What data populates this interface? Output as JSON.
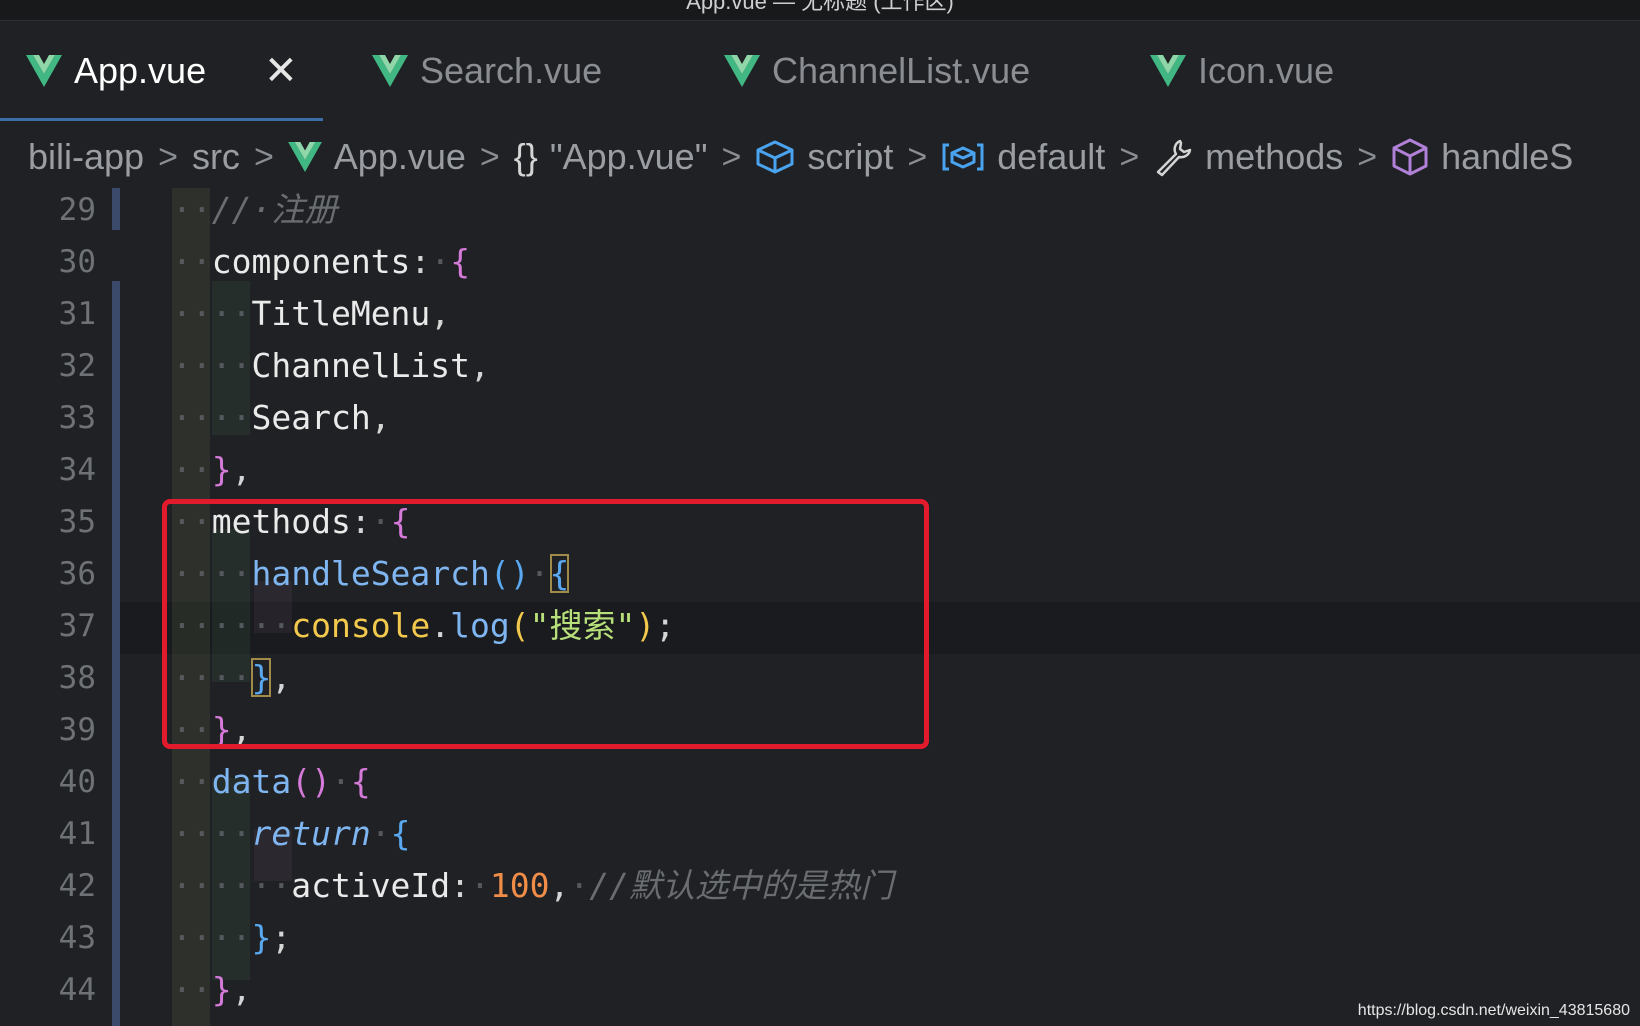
{
  "window": {
    "title": "App.vue — 无标题 (工作区)"
  },
  "tabs": [
    {
      "label": "App.vue",
      "active": true,
      "icon": "vue-icon"
    },
    {
      "label": "Search.vue",
      "active": false,
      "icon": "vue-icon"
    },
    {
      "label": "ChannelList.vue",
      "active": false,
      "icon": "vue-icon"
    },
    {
      "label": "Icon.vue",
      "active": false,
      "icon": "vue-icon"
    }
  ],
  "breadcrumb": [
    {
      "label": "bili-app",
      "icon": null
    },
    {
      "label": "src",
      "icon": null
    },
    {
      "label": "App.vue",
      "icon": "vue-icon"
    },
    {
      "label": "\"App.vue\"",
      "icon": "braces-icon",
      "icon_text": "{}"
    },
    {
      "label": "script",
      "icon": "cube-icon"
    },
    {
      "label": "default",
      "icon": "module-icon"
    },
    {
      "label": "methods",
      "icon": "wrench-icon"
    },
    {
      "label": "handleS",
      "icon": "method-cube-icon"
    }
  ],
  "editor": {
    "line_numbers": [
      "29",
      "30",
      "31",
      "32",
      "33",
      "34",
      "35",
      "36",
      "37",
      "38",
      "39",
      "40",
      "41",
      "42",
      "43",
      "44"
    ],
    "lines": [
      {
        "ws": "··",
        "tokens": [
          {
            "t": "//·注册",
            "c": "c-com"
          }
        ]
      },
      {
        "ws": "··",
        "tokens": [
          {
            "t": "components",
            "c": "c-prop"
          },
          {
            "t": ":",
            "c": "c-punc"
          },
          {
            "t": "·",
            "c": "ws"
          },
          {
            "t": "{",
            "c": "c-brace1"
          }
        ]
      },
      {
        "ws": "····",
        "tokens": [
          {
            "t": "TitleMenu",
            "c": "c-prop"
          },
          {
            "t": ",",
            "c": "c-punc"
          }
        ]
      },
      {
        "ws": "····",
        "tokens": [
          {
            "t": "ChannelList",
            "c": "c-prop"
          },
          {
            "t": ",",
            "c": "c-punc"
          }
        ]
      },
      {
        "ws": "····",
        "tokens": [
          {
            "t": "Search",
            "c": "c-prop"
          },
          {
            "t": ",",
            "c": "c-punc"
          }
        ]
      },
      {
        "ws": "··",
        "tokens": [
          {
            "t": "}",
            "c": "c-brace1"
          },
          {
            "t": ",",
            "c": "c-punc"
          }
        ]
      },
      {
        "ws": "··",
        "tokens": [
          {
            "t": "methods",
            "c": "c-prop"
          },
          {
            "t": ":",
            "c": "c-punc"
          },
          {
            "t": "·",
            "c": "ws"
          },
          {
            "t": "{",
            "c": "c-brace1"
          }
        ]
      },
      {
        "ws": "····",
        "tokens": [
          {
            "t": "handleSearch",
            "c": "c-fn"
          },
          {
            "t": "()",
            "c": "c-brace2"
          },
          {
            "t": "·",
            "c": "ws"
          },
          {
            "t": "{",
            "c": "c-brace2 bracket-box"
          }
        ]
      },
      {
        "ws": "······",
        "tokens": [
          {
            "t": "console",
            "c": "c-obj"
          },
          {
            "t": ".",
            "c": "c-punc"
          },
          {
            "t": "log",
            "c": "c-fn"
          },
          {
            "t": "(",
            "c": "c-obj"
          },
          {
            "t": "\"搜索\"",
            "c": "c-str"
          },
          {
            "t": ")",
            "c": "c-obj"
          },
          {
            "t": ";",
            "c": "c-punc"
          }
        ]
      },
      {
        "ws": "····",
        "tokens": [
          {
            "t": "}",
            "c": "c-brace2 bracket-box"
          },
          {
            "t": ",",
            "c": "c-punc"
          }
        ]
      },
      {
        "ws": "··",
        "tokens": [
          {
            "t": "}",
            "c": "c-brace1"
          },
          {
            "t": ",",
            "c": "c-punc"
          }
        ]
      },
      {
        "ws": "··",
        "tokens": [
          {
            "t": "data",
            "c": "c-fn"
          },
          {
            "t": "()",
            "c": "c-brace1"
          },
          {
            "t": "·",
            "c": "ws"
          },
          {
            "t": "{",
            "c": "c-brace1"
          }
        ]
      },
      {
        "ws": "····",
        "tokens": [
          {
            "t": "return",
            "c": "c-kw"
          },
          {
            "t": "·",
            "c": "ws"
          },
          {
            "t": "{",
            "c": "c-brace2"
          }
        ]
      },
      {
        "ws": "······",
        "tokens": [
          {
            "t": "activeId",
            "c": "c-prop"
          },
          {
            "t": ":",
            "c": "c-punc"
          },
          {
            "t": "·",
            "c": "ws"
          },
          {
            "t": "100",
            "c": "c-num"
          },
          {
            "t": ",",
            "c": "c-punc"
          },
          {
            "t": "·",
            "c": "ws"
          },
          {
            "t": "//默认选中的是热门",
            "c": "c-com"
          }
        ]
      },
      {
        "ws": "····",
        "tokens": [
          {
            "t": "}",
            "c": "c-brace2"
          },
          {
            "t": ";",
            "c": "c-punc"
          }
        ]
      },
      {
        "ws": "··",
        "tokens": [
          {
            "t": "}",
            "c": "c-brace1"
          },
          {
            "t": ",",
            "c": "c-punc"
          }
        ]
      }
    ],
    "current_line": "37",
    "annotation_color": "#e21b2c"
  },
  "watermark": "https://blog.csdn.net/weixin_43815680"
}
